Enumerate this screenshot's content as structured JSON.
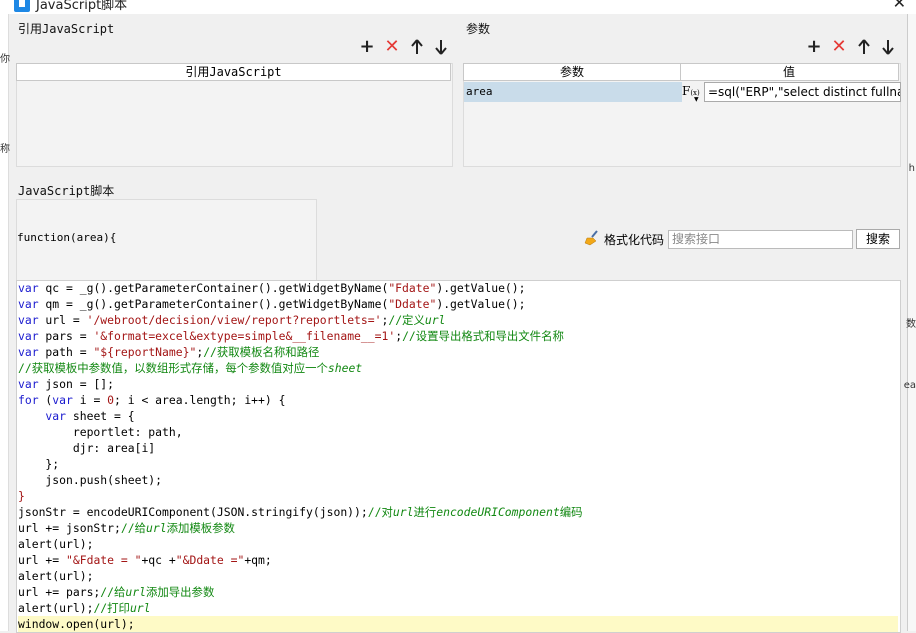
{
  "window": {
    "title": "JavaScript脚本",
    "close_label": "✕"
  },
  "background_fragments": [
    "你",
    "称",
    "h",
    "数",
    "ea"
  ],
  "ref_section": {
    "label": "引用JavaScript",
    "column_header": "引用JavaScript",
    "toolbar": {
      "add": "+",
      "delete": "✕",
      "up": "up-arrow",
      "down": "down-arrow"
    }
  },
  "params_section": {
    "label": "参数",
    "columns": [
      "参数",
      "值"
    ],
    "rows": [
      {
        "name": "area",
        "fx": "F",
        "fx_sub": "(x)",
        "value": "=sql(\"ERP\",\"select distinct fullnam"
      }
    ],
    "toolbar": {
      "add": "+",
      "delete": "✕",
      "up": "up-arrow",
      "down": "down-arrow"
    }
  },
  "script_section": {
    "label": "JavaScript脚本",
    "function_signature": "function(area){",
    "format_label": "格式化代码",
    "search_placeholder": "搜索接口",
    "search_button": "搜索"
  },
  "code": {
    "l1a": "var",
    "l1b": " qc = _g().getParameterContainer().getWidgetByName(",
    "l1c": "\"Fdate\"",
    "l1d": ").getValue();",
    "l2a": "var",
    "l2b": " qm = _g().getParameterContainer().getWidgetByName(",
    "l2c": "\"Ddate\"",
    "l2d": ").getValue();",
    "l3a": "var",
    "l3b": " url = ",
    "l3c": "'/webroot/decision/view/report?reportlets='",
    "l3d": ";",
    "l3e": "//定义",
    "l3f": "url",
    "l4a": "var",
    "l4b": " pars = ",
    "l4c": "'&format=excel&extype=simple&__filename__=1'",
    "l4d": ";",
    "l4e": "//设置导出格式和导出文件名称",
    "l5a": "var",
    "l5b": " path = ",
    "l5c": "\"${reportName}\"",
    "l5d": ";",
    "l5e": "//获取模板名称和路径",
    "l6a": "//获取模板中参数值，以数组形式存储，每个参数值对应一个",
    "l6b": "sheet",
    "l7a": "var",
    "l7b": " json = [];",
    "l8a": "for",
    "l8b": " (",
    "l8c": "var",
    "l8d": " i = ",
    "l8e": "0",
    "l8f": "; i < area.length; i++) {",
    "l9a": "    var",
    "l9b": " sheet = {",
    "l10": "        reportlet: path,",
    "l11a": "        djr: area[i]",
    "l12": "    };",
    "l13": "    json.push(sheet);",
    "l14": "}",
    "l15a": "jsonStr = encodeURIComponent(JSON.stringify(json));",
    "l15b": "//对",
    "l15c": "url",
    "l15d": "进行",
    "l15e": "encodeURIComponent",
    "l15f": "编码",
    "l16a": "url += jsonStr;",
    "l16b": "//给",
    "l16c": "url",
    "l16d": "添加模板参数",
    "l17": "alert(url);",
    "l18a": "url += ",
    "l18b": "\"&Fdate = \"",
    "l18c": "+qc +",
    "l18d": "\"&Ddate =\"",
    "l18e": "+qm;",
    "l19": "alert(url);",
    "l20a": "url += pars;",
    "l20b": "//给",
    "l20c": "url",
    "l20d": "添加导出参数",
    "l21a": "alert(url);",
    "l21b": "//打印",
    "l21c": "url",
    "l22": "window.open(url);"
  },
  "colors": {
    "keyword": "#1b1bcf",
    "string": "#a31515",
    "comment": "#128812",
    "selected_row": "#c9dcea",
    "current_line": "#fefac6"
  }
}
